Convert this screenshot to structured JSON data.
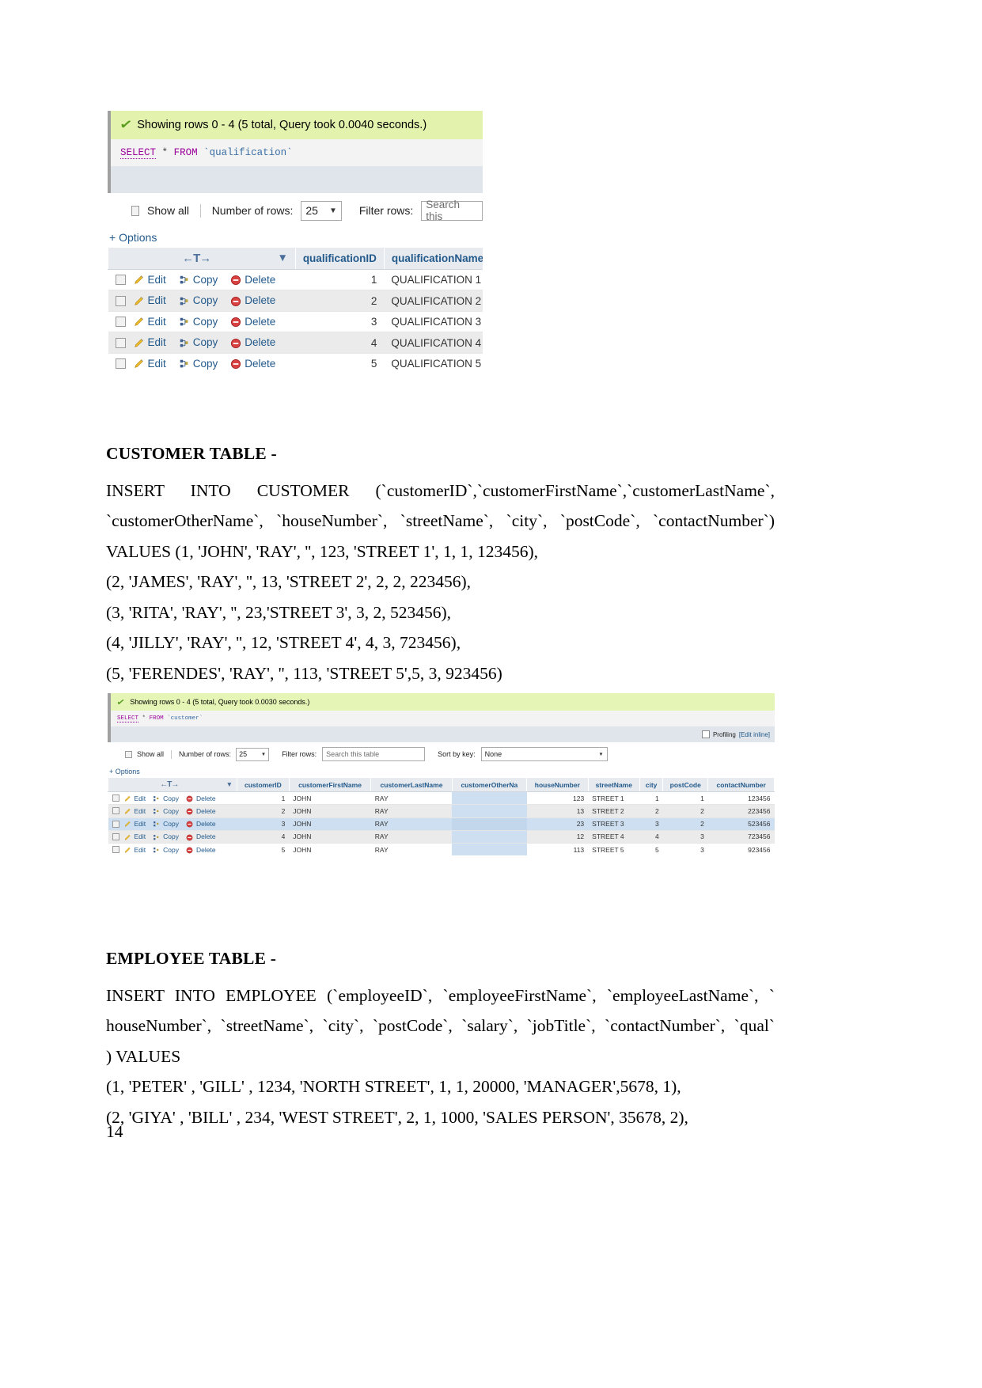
{
  "document": {
    "page_number": "14",
    "sections": [
      {
        "heading": "CUSTOMER TABLE -",
        "lines": [
          "INSERT INTO CUSTOMER (`customerID`,`customerFirstName`,`customerLastName`,",
          "`customerOtherName`, `houseNumber`, `streetName`, `city`, `postCode`, `contactNumber`)",
          "VALUES (1, 'JOHN', 'RAY', '', 123, 'STREET 1', 1, 1, 123456),",
          "(2, 'JAMES', 'RAY', '', 13, 'STREET 2', 2, 2, 223456),",
          "(3, 'RITA', 'RAY', '', 23,'STREET 3', 3, 2, 523456),",
          "(4, 'JILLY', 'RAY', '', 12, 'STREET 4', 4, 3, 723456),",
          "(5, 'FERENDES', 'RAY', '', 113, 'STREET 5',5, 3, 923456)"
        ]
      },
      {
        "heading": "EMPLOYEE TABLE -",
        "lines": [
          "INSERT INTO EMPLOYEE (`employeeID`, `employeeFirstName`, `employeeLastName`, `",
          "houseNumber`, `streetName`, `city`, `postCode`, `salary`, `jobTitle`, `contactNumber`, `qual`",
          ") VALUES",
          "(1, 'PETER' , 'GILL' , 1234, 'NORTH STREET', 1, 1, 20000, 'MANAGER',5678, 1),",
          "(2, 'GIYA' , 'BILL' , 234, 'WEST STREET', 2, 1, 1000, 'SALES PERSON', 35678, 2),"
        ]
      }
    ]
  },
  "qualification_screenshot": {
    "status_text": "Showing rows 0 - 4 (5 total, Query took 0.0040 seconds.)",
    "sql": {
      "select": "SELECT",
      "star": "*",
      "from": "FROM",
      "table": "`qualification`"
    },
    "controls": {
      "show_all_label": "Show all",
      "number_of_rows_label": "Number of rows:",
      "number_of_rows_value": "25",
      "filter_rows_label": "Filter rows:",
      "filter_placeholder": "Search this"
    },
    "options_label": "+ Options",
    "actions": {
      "edit": "Edit",
      "copy": "Copy",
      "delete": "Delete"
    },
    "columns": [
      "qualificationID",
      "qualificationName"
    ],
    "rows": [
      {
        "id": "1",
        "name": "QUALIFICATION 1"
      },
      {
        "id": "2",
        "name": "QUALIFICATION 2"
      },
      {
        "id": "3",
        "name": "QUALIFICATION 3"
      },
      {
        "id": "4",
        "name": "QUALIFICATION 4"
      },
      {
        "id": "5",
        "name": "QUALIFICATION 5"
      }
    ]
  },
  "customer_screenshot": {
    "status_text": "Showing rows 0 - 4 (5 total, Query took 0.0030 seconds.)",
    "sql": {
      "select": "SELECT",
      "star": "*",
      "from": "FROM",
      "table": "`customer`"
    },
    "profiling_label": "Profiling",
    "edit_inline_label": "[Edit inline]",
    "controls": {
      "show_all_label": "Show all",
      "number_of_rows_label": "Number of rows:",
      "number_of_rows_value": "25",
      "filter_rows_label": "Filter rows:",
      "filter_placeholder": "Search this table",
      "sort_by_key_label": "Sort by key:",
      "sort_by_key_value": "None"
    },
    "options_label": "+ Options",
    "actions": {
      "edit": "Edit",
      "copy": "Copy",
      "delete": "Delete"
    },
    "columns": [
      "customerID",
      "customerFirstName",
      "customerLastName",
      "customerOtherNa",
      "houseNumber",
      "streetName",
      "city",
      "postCode",
      "contactNumber"
    ],
    "rows": [
      {
        "id": "1",
        "first": "JOHN",
        "last": "RAY",
        "other": "",
        "house": "123",
        "street": "STREET 1",
        "city": "1",
        "post": "1",
        "contact": "123456"
      },
      {
        "id": "2",
        "first": "JOHN",
        "last": "RAY",
        "other": "",
        "house": "13",
        "street": "STREET 2",
        "city": "2",
        "post": "2",
        "contact": "223456"
      },
      {
        "id": "3",
        "first": "JOHN",
        "last": "RAY",
        "other": "",
        "house": "23",
        "street": "STREET 3",
        "city": "3",
        "post": "2",
        "contact": "523456"
      },
      {
        "id": "4",
        "first": "JOHN",
        "last": "RAY",
        "other": "",
        "house": "12",
        "street": "STREET 4",
        "city": "4",
        "post": "3",
        "contact": "723456"
      },
      {
        "id": "5",
        "first": "JOHN",
        "last": "RAY",
        "other": "",
        "house": "113",
        "street": "STREET 5",
        "city": "5",
        "post": "3",
        "contact": "923456"
      }
    ]
  }
}
